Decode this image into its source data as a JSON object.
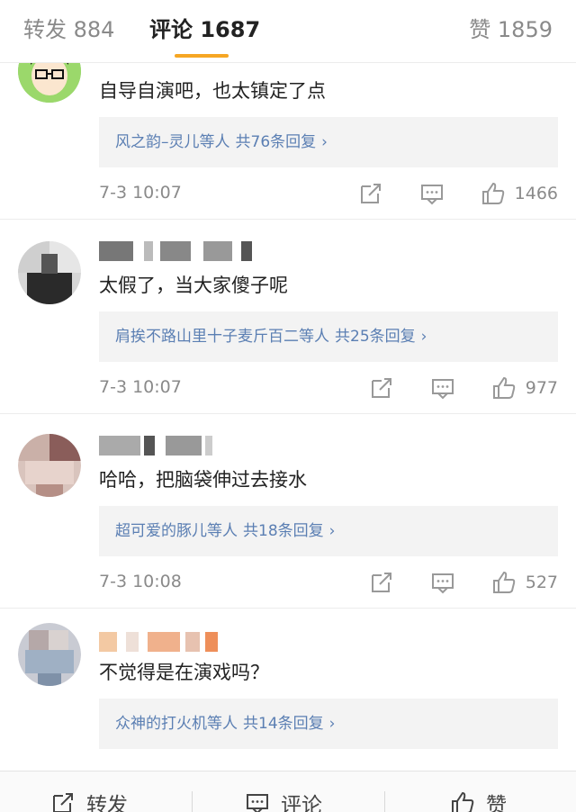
{
  "tabs": {
    "repost": "转发 884",
    "comments": "评论 1687",
    "likes": "赞 1859"
  },
  "comments": [
    {
      "text": "自导自演吧，也太镇定了点",
      "reply_users": "风之韵–灵儿等人",
      "reply_count": "共76条回复",
      "time": "7-3 10:07",
      "likes": "1466"
    },
    {
      "text": "太假了，当大家傻子呢",
      "reply_users": "肩挨不路山里十子麦斤百二等人",
      "reply_count": "共25条回复",
      "time": "7-3 10:07",
      "likes": "977"
    },
    {
      "text": "哈哈，把脑袋伸过去接水",
      "reply_users": "超可爱的豚儿等人",
      "reply_count": "共18条回复",
      "time": "7-3 10:08",
      "likes": "527"
    },
    {
      "text": "不觉得是在演戏吗？",
      "reply_users": "众神的打火机等人",
      "reply_count": "共14条回复",
      "time": "",
      "likes": ""
    }
  ],
  "bottom_bar": {
    "repost": "转发",
    "comment": "评论",
    "like": "赞"
  },
  "colors": {
    "accent_underline": "#f6a623",
    "link_blue": "#5b7fb3",
    "meta_gray": "#8a8a8a"
  }
}
